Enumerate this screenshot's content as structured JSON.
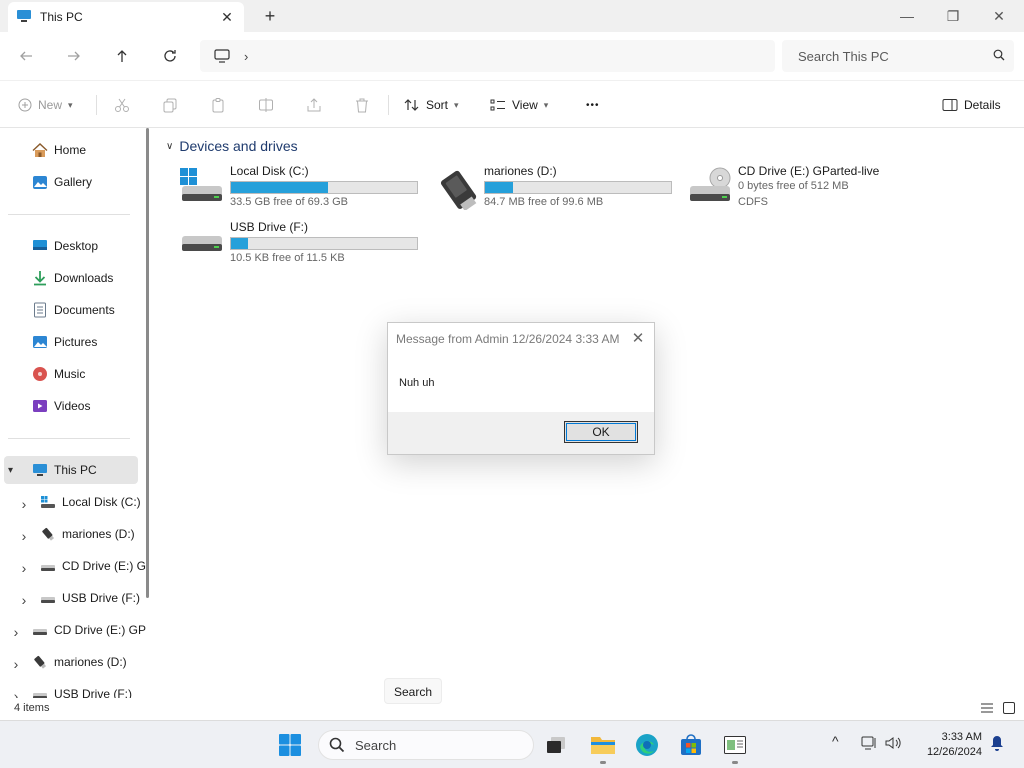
{
  "window": {
    "tab_title": "This PC",
    "new_tab_glyph": "+",
    "minimize_glyph": "—",
    "maximize_glyph": "❐",
    "close_glyph": "✕"
  },
  "address": {
    "chevron": "›",
    "search_placeholder": "Search This PC"
  },
  "commands": {
    "new": "New",
    "sort": "Sort",
    "view": "View",
    "more": "•••",
    "details": "Details"
  },
  "nav": {
    "home": "Home",
    "gallery": "Gallery",
    "pinned": [
      {
        "label": "Desktop",
        "icon": "desktop-icon",
        "color": "#1e90d6"
      },
      {
        "label": "Downloads",
        "icon": "downloads-icon",
        "color": "#2e9e5b"
      },
      {
        "label": "Documents",
        "icon": "documents-icon",
        "color": "#6b7b8c"
      },
      {
        "label": "Pictures",
        "icon": "pictures-icon",
        "color": "#2c86d3"
      },
      {
        "label": "Music",
        "icon": "music-icon",
        "color": "#d9534f"
      },
      {
        "label": "Videos",
        "icon": "videos-icon",
        "color": "#7b3fbf"
      }
    ],
    "this_pc": "This PC",
    "tree": [
      {
        "label": "Local Disk (C:)"
      },
      {
        "label": "mariones (D:)"
      },
      {
        "label": "CD Drive (E:) G"
      },
      {
        "label": "USB Drive (F:)"
      },
      {
        "label": "CD Drive (E:) GP"
      },
      {
        "label": "mariones (D:)"
      },
      {
        "label": "USB Drive (F:)"
      }
    ]
  },
  "content": {
    "group_title": "Devices and drives",
    "drives": [
      {
        "name": "Local Disk (C:)",
        "free": "33.5 GB free of 69.3 GB",
        "used_fraction": 0.52
      },
      {
        "name": "mariones (D:)",
        "free": "84.7 MB free of 99.6 MB",
        "used_fraction": 0.15
      },
      {
        "name": "CD Drive (E:) GParted-live",
        "free": "0 bytes free of 512 MB",
        "fs": "CDFS"
      },
      {
        "name": "USB Drive (F:)",
        "free": "10.5 KB free of 11.5 KB",
        "used_fraction": 0.09
      }
    ]
  },
  "status": {
    "items_count": "4 items",
    "tooltip": "Search"
  },
  "dialog": {
    "title": "Message from Admin 12/26/2024 3:33 AM",
    "message": "Nuh uh",
    "ok_label": "OK",
    "close_glyph": "✕"
  },
  "taskbar": {
    "search_placeholder": "Search",
    "time": "3:33 AM",
    "date": "12/26/2024",
    "tray_chevron": "^"
  },
  "colors": {
    "accent": "#0078d4",
    "bar_fill": "#26a0da",
    "group_header": "#1f3b6e"
  }
}
